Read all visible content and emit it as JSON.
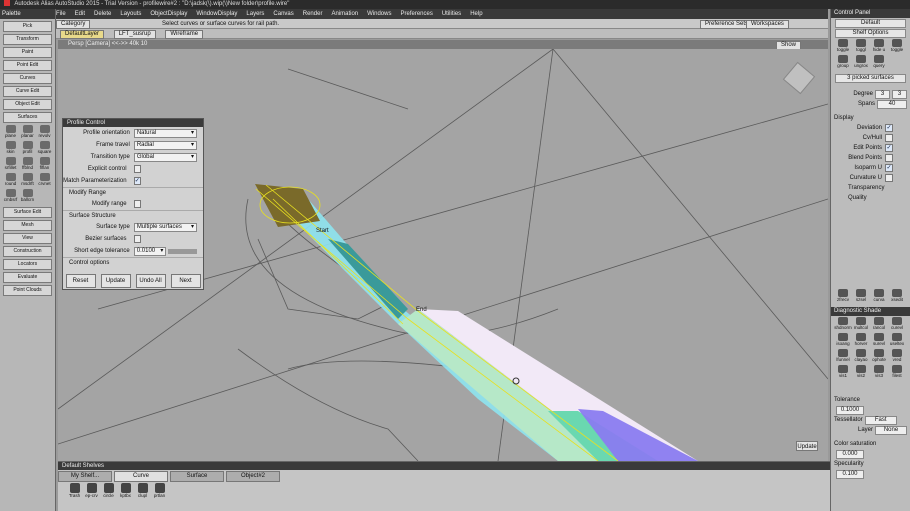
{
  "window": {
    "title": "Autodesk Alias AutoStudio 2015 - Trial Version - profilewire#2 : \"D:\\jadsk(\\).wip(\\)New folder\\profile.wire\""
  },
  "menu": [
    "File",
    "Edit",
    "Delete",
    "Layouts",
    "ObjectDisplay",
    "WindowDisplay",
    "Layers",
    "Canvas",
    "Render",
    "Animation",
    "Windows",
    "Preferences",
    "Utilities",
    "Help"
  ],
  "toolbar": {
    "category_label": "Category",
    "prompt": "Select curves or surface curves for rail path.",
    "preference_sets": "Preference Sets",
    "workspaces": "Workspaces",
    "layer_default": "DefaultLayer",
    "layer_lft": "LFT_susrup",
    "layer_wf": "Wireframe"
  },
  "viewport": {
    "header": "Persp [Camera] <<->>  40k 10",
    "show_label": "Show",
    "update_btn": "Update"
  },
  "palette": {
    "title": "Palette",
    "top_buttons": [
      "Pick",
      "Transform",
      "Paint",
      "Point Edit",
      "Curves",
      "Curve Edit",
      "Object Edit",
      "Surfaces"
    ],
    "surface_tools": [
      "plane",
      "planar",
      "revolv",
      "skin",
      "profil",
      "square",
      "srfillet",
      "ffblnd",
      "flflan",
      "round",
      "msdrft",
      "crvnet",
      "cmbsrf",
      "ballcrn"
    ],
    "bottom_buttons": [
      "Surface Edit",
      "Mesh",
      "View",
      "Construction",
      "Locators",
      "Evaluate",
      "Point Clouds"
    ]
  },
  "profile_control": {
    "title": "Profile Control",
    "rows": [
      {
        "label": "Profile orientation",
        "value": "Natural"
      },
      {
        "label": "Frame travel",
        "value": "Radial"
      },
      {
        "label": "Transition type",
        "value": "Global"
      }
    ],
    "explicit_control": "Explicit control",
    "match_param": "Match Parameterization",
    "modify_range_section": "Modify Range",
    "modify_range": "Modify range",
    "surface_structure_section": "Surface Structure",
    "surface_type_label": "Surface type",
    "surface_type_value": "Multiple surfaces",
    "bezier": "Bezier surfaces",
    "short_edge_label": "Short edge tolerance",
    "short_edge_value": "0.0100",
    "control_options": "Control options",
    "buttons": [
      "Reset",
      "Update",
      "Undo All",
      "Next"
    ]
  },
  "control_panel": {
    "title": "Control Panel",
    "default": "Default",
    "shelf_options": "Shelf Options",
    "shelf_icons": [
      "toggle",
      "toggl",
      "hide u",
      "toggle",
      "group",
      "ungrox",
      "query"
    ],
    "picked": "3 picked surfaces",
    "degree_label": "Degree",
    "degree": [
      "3",
      "3"
    ],
    "spans_label": "Spans",
    "spans": "40",
    "display": "Display",
    "display_items": [
      "Deviation",
      "Cv/Hull",
      "Edit Points",
      "Blend Points",
      "Isoparm U",
      "Curvature U"
    ],
    "transparency": "Transparency",
    "quality": "Quality",
    "mini_tools": [
      "zfrecv",
      "szsel",
      "curva",
      "xsedit"
    ],
    "diag_title": "Diagnostic Shade",
    "diag_tools": [
      "shdnorm",
      "multcol",
      "rancol",
      "curevl",
      "isoang",
      "horver",
      "surevl",
      "useltex",
      "lfunnel",
      "clayao",
      "ophote",
      "vred",
      "vis1",
      "vis2",
      "vis3",
      "filest"
    ],
    "tolerance_label": "Tolerance",
    "tolerance": "0.1000",
    "tessellator_label": "Tessellator",
    "tessellator": "Fast",
    "layer_label": "Layer",
    "layer": "None",
    "color_sat_label": "Color saturation",
    "color_sat": "0.000",
    "specularity_label": "Specularity",
    "specularity": "0.100"
  },
  "shelves": {
    "title": "Default Shelves",
    "tabs": [
      "My Shelf...",
      "Curve",
      "Surface",
      "Object#2"
    ],
    "tools": [
      "Trash",
      "ep-crv",
      "circle",
      "kptbx",
      "clupl",
      "prtlan"
    ]
  },
  "annotations": {
    "start": "Start",
    "end": "End"
  }
}
